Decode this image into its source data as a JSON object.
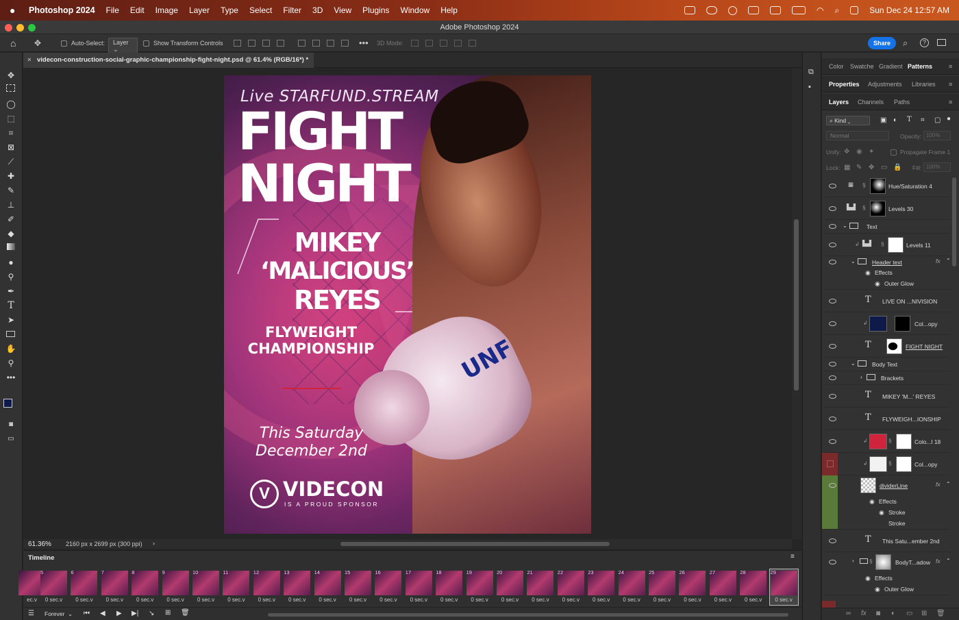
{
  "menubar": {
    "app": "Photoshop 2024",
    "items": [
      "File",
      "Edit",
      "Image",
      "Layer",
      "Type",
      "Select",
      "Filter",
      "3D",
      "View",
      "Plugins",
      "Window",
      "Help"
    ],
    "datetime": "Sun Dec 24  12:57 AM"
  },
  "window": {
    "title": "Adobe Photoshop 2024"
  },
  "options": {
    "auto_select_label": "Auto-Select:",
    "auto_select_value": "Layer",
    "transform_label": "Show Transform Controls",
    "mode3d": "3D Mode:",
    "share": "Share"
  },
  "document": {
    "tab": "videcon-construction-social-graphic-championship-fight-night.psd @ 61.4% (RGB/16*) *",
    "zoom": "61.36%",
    "dims": "2160 px x 2699 px (300 ppi)"
  },
  "poster": {
    "live": "Live STARFUND.STREAM",
    "fight": "FIGHT",
    "night": "NIGHT",
    "name1": "MIKEY",
    "name2": "‘MALICIOUS’",
    "name3": "REYES",
    "champ1": "FLYWEIGHT",
    "champ2": "CHAMPIONSHIP",
    "date1": "This Saturday",
    "date2": "December 2nd",
    "brand": "VIDECON",
    "sponsor": "IS A PROUD SPONSOR",
    "glove": "UNF"
  },
  "timeline": {
    "title": "Timeline",
    "loop": "Forever",
    "frames": [
      {
        "n": "",
        "d": "ec.v"
      },
      {
        "n": "5",
        "d": "0 sec.v"
      },
      {
        "n": "6",
        "d": "0 sec.v"
      },
      {
        "n": "7",
        "d": "0 sec.v"
      },
      {
        "n": "8",
        "d": "0 sec.v"
      },
      {
        "n": "9",
        "d": "0 sec.v"
      },
      {
        "n": "10",
        "d": "0 sec.v"
      },
      {
        "n": "11",
        "d": "0 sec.v"
      },
      {
        "n": "12",
        "d": "0 sec.v"
      },
      {
        "n": "13",
        "d": "0 sec.v"
      },
      {
        "n": "14",
        "d": "0 sec.v"
      },
      {
        "n": "15",
        "d": "0 sec.v"
      },
      {
        "n": "16",
        "d": "0 sec.v"
      },
      {
        "n": "17",
        "d": "0 sec.v"
      },
      {
        "n": "18",
        "d": "0 sec.v"
      },
      {
        "n": "19",
        "d": "0 sec.v"
      },
      {
        "n": "20",
        "d": "0 sec.v"
      },
      {
        "n": "21",
        "d": "0 sec.v"
      },
      {
        "n": "22",
        "d": "0 sec.v"
      },
      {
        "n": "23",
        "d": "0 sec.v"
      },
      {
        "n": "24",
        "d": "0 sec.v"
      },
      {
        "n": "25",
        "d": "0 sec.v"
      },
      {
        "n": "26",
        "d": "0 sec.v"
      },
      {
        "n": "27",
        "d": "0 sec.v"
      },
      {
        "n": "28",
        "d": "0 sec.v"
      },
      {
        "n": "29",
        "d": "0 sec.v"
      }
    ]
  },
  "panels": {
    "top_tabs": [
      "Color",
      "Swatche",
      "Gradient",
      "Patterns"
    ],
    "mid_tabs": [
      "Properties",
      "Adjustments",
      "Libraries"
    ],
    "layer_tabs": [
      "Layers",
      "Channels",
      "Paths"
    ],
    "kind": "Kind",
    "blend": "Normal",
    "opacity_label": "Opacity:",
    "opacity": "100%",
    "unify": "Unify:",
    "propagate": "Propagate Frame 1",
    "lock": "Lock:",
    "fill_label": "Fill:",
    "fill": "100%",
    "layers": [
      "Hue/Saturation 4",
      "Levels 30",
      "Text",
      "Levels 11",
      "Header text",
      "Effects",
      "Outer Glow",
      "LIVE ON ...NIVISION",
      "Col...opy",
      "FIGHT  NIGHT",
      "Body Text",
      "Brackets",
      "MIKEY  'M...'  REYES",
      "FLYWEIGH...IONSHIP",
      "Colo...l 18",
      "Col...opy",
      "dividerLine",
      "Effects",
      "Stroke",
      "Stroke",
      "This Satu...ember 2nd",
      "BodyT...adow",
      "Effects",
      "Outer Glow"
    ]
  },
  "colors": {
    "menubar": "#8c2e16",
    "share": "#1473e6",
    "poster_pink": "#c0366f",
    "accent_red": "#d0243c"
  }
}
